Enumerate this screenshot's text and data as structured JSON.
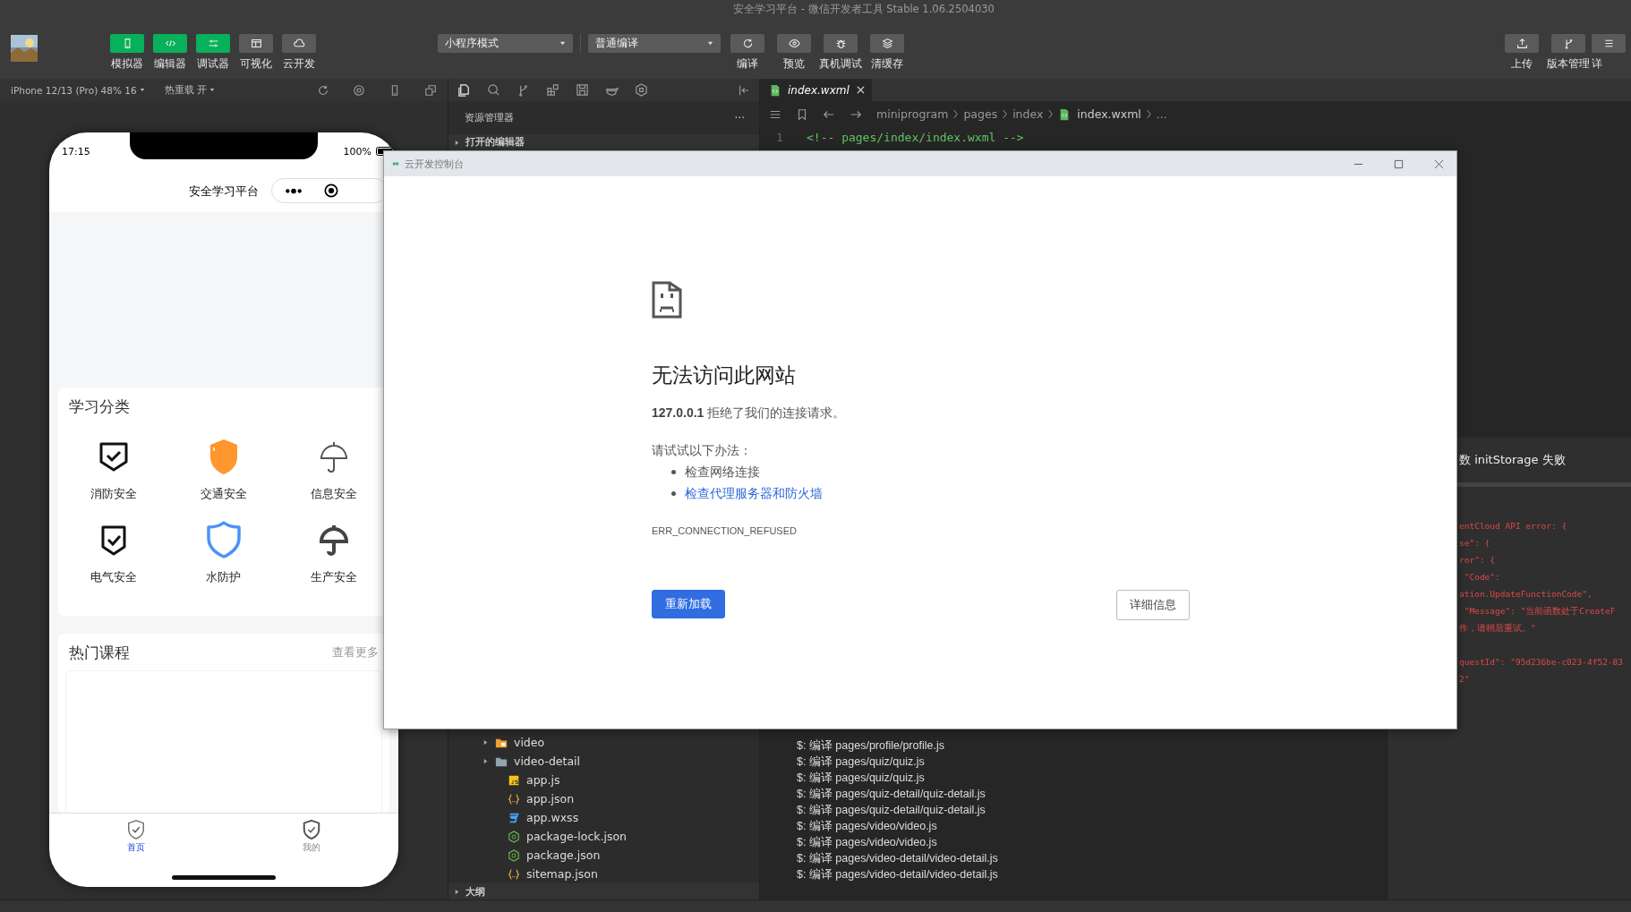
{
  "window": {
    "title": "安全学习平台 - 微信开发者工具 Stable 1.06.2504030"
  },
  "toolbar": {
    "view_buttons": [
      {
        "label": "模拟器",
        "selected": true
      },
      {
        "label": "编辑器",
        "selected": true
      },
      {
        "label": "调试器",
        "selected": true
      },
      {
        "label": "可视化",
        "selected": false
      },
      {
        "label": "云开发",
        "selected": false
      }
    ],
    "mode_select": "小程序模式",
    "compile_select": "普通编译",
    "actions": [
      {
        "label": "编译"
      },
      {
        "label": "预览"
      },
      {
        "label": "真机调试"
      },
      {
        "label": "清缓存"
      }
    ],
    "right_actions": [
      {
        "label": "上传"
      },
      {
        "label": "版本管理"
      },
      {
        "label": "详"
      }
    ]
  },
  "simulator_bar": {
    "device": "iPhone 12/13 (Pro) 48% 16",
    "hot_reload": "热重载 开"
  },
  "phone": {
    "time": "17:15",
    "battery": "100%",
    "title": "安全学习平台",
    "categories": {
      "title": "学习分类",
      "items": [
        {
          "label": "消防安全"
        },
        {
          "label": "交通安全"
        },
        {
          "label": "信息安全"
        },
        {
          "label": "电气安全"
        },
        {
          "label": "水防护"
        },
        {
          "label": "生产安全"
        }
      ]
    },
    "courses": {
      "title": "热门课程",
      "more": "查看更多"
    },
    "tabbar": [
      {
        "label": "首页",
        "selected": true
      },
      {
        "label": "我的",
        "selected": false
      }
    ]
  },
  "explorer": {
    "title": "资源管理器",
    "more": "···",
    "open_editors": "打开的编辑器",
    "tree": [
      {
        "label": "video",
        "kind": "media-folder"
      },
      {
        "label": "video-detail",
        "kind": "folder"
      },
      {
        "label": "app.js",
        "kind": "js"
      },
      {
        "label": "app.json",
        "kind": "json"
      },
      {
        "label": "app.wxss",
        "kind": "css"
      },
      {
        "label": "package-lock.json",
        "kind": "node"
      },
      {
        "label": "package.json",
        "kind": "node"
      },
      {
        "label": "sitemap.json",
        "kind": "json"
      }
    ],
    "outline": "大纲"
  },
  "editor": {
    "tab": {
      "label": "index.wxml",
      "selected": true
    },
    "breadcrumb": [
      {
        "label": "miniprogram",
        "kind": "folder"
      },
      {
        "label": "pages",
        "kind": "folder"
      },
      {
        "label": "index",
        "kind": "folder"
      },
      {
        "label": "index.wxml",
        "kind": "file"
      },
      {
        "label": "...",
        "kind": "more"
      }
    ],
    "lines": [
      {
        "number": "1",
        "code": "<!-- pages/index/index.wxml -->"
      }
    ]
  },
  "console": {
    "lines": [
      "$: 编译 pages/profile/profile.js",
      "$: 编译 pages/quiz/quiz.js",
      "$: 编译 pages/quiz/quiz.js",
      "$: 编译 pages/quiz-detail/quiz-detail.js",
      "$: 编译 pages/quiz-detail/quiz-detail.js",
      "$: 编译 pages/video/video.js",
      "$: 编译 pages/video/video.js",
      "$: 编译 pages/video-detail/video-detail.js",
      "$: 编译 pages/video-detail/video-detail.js"
    ]
  },
  "error_panel": {
    "title": "数 initStorage 失败",
    "lines": [
      "entCloud API error: {",
      "se\": {",
      "ror\": {",
      " \"Code\":",
      "ation.UpdateFunctionCode\",",
      " \"Message\": \"当前函数处于CreateF",
      "作，请稍后重试。\""
    ],
    "request_lines": [
      "questId\": \"95d236be-c023-4f52-83",
      "2\""
    ]
  },
  "dialog": {
    "title": "云开发控制台",
    "heading": "无法访问此网站",
    "message": "**127.0.0.1** 拒绝了我们的连接请求。",
    "suggest": "请试试以下办法：",
    "suggestions": [
      {
        "text": "检查网络连接",
        "kind": "text"
      },
      {
        "text": "检查代理服务器和防火墙",
        "kind": "link"
      }
    ],
    "error_code": "ERR_CONNECTION_REFUSED",
    "buttons": [
      {
        "label": "重新加载",
        "kind": "primary"
      },
      {
        "label": "详细信息",
        "kind": "secondary"
      }
    ]
  }
}
